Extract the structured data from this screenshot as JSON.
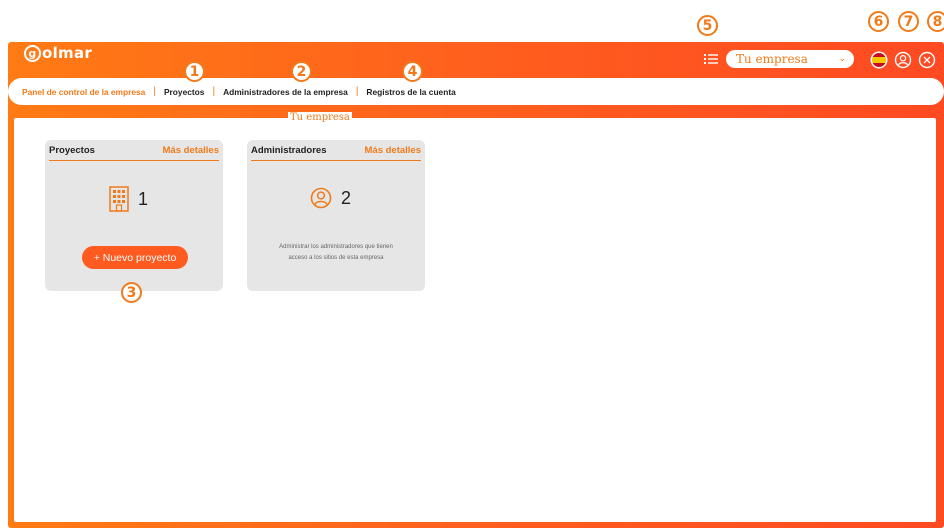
{
  "brand": {
    "logo_letter": "g",
    "logo_rest": "olmar"
  },
  "company_selector": {
    "value": "Tu empresa"
  },
  "company_caption": "Tu empresa",
  "tabs": [
    {
      "label": "Panel de control de la empresa",
      "active": true
    },
    {
      "label": "Proyectos",
      "active": false
    },
    {
      "label": "Administradores de la empresa",
      "active": false
    },
    {
      "label": "Registros de la cuenta",
      "active": false
    }
  ],
  "tab_separator": "|",
  "callouts": [
    "1",
    "2",
    "3",
    "4",
    "5",
    "6",
    "7",
    "8"
  ],
  "cards": {
    "projects": {
      "title": "Proyectos",
      "details_link": "Más detalles",
      "count": "1",
      "icon": "building-icon",
      "button_label": "+ Nuevo proyecto"
    },
    "admins": {
      "title": "Administradores",
      "details_link": "Más detalles",
      "count": "2",
      "icon": "user-circle-icon",
      "description_line1": "Administrar los administradores que tienen",
      "description_line2": "acceso a los sitios de esta empresa"
    }
  },
  "colors": {
    "accent": "#f07a1a",
    "frame_start": "#ff7b14",
    "frame_end": "#ff4a22",
    "card_bg": "#e6e6e6"
  }
}
